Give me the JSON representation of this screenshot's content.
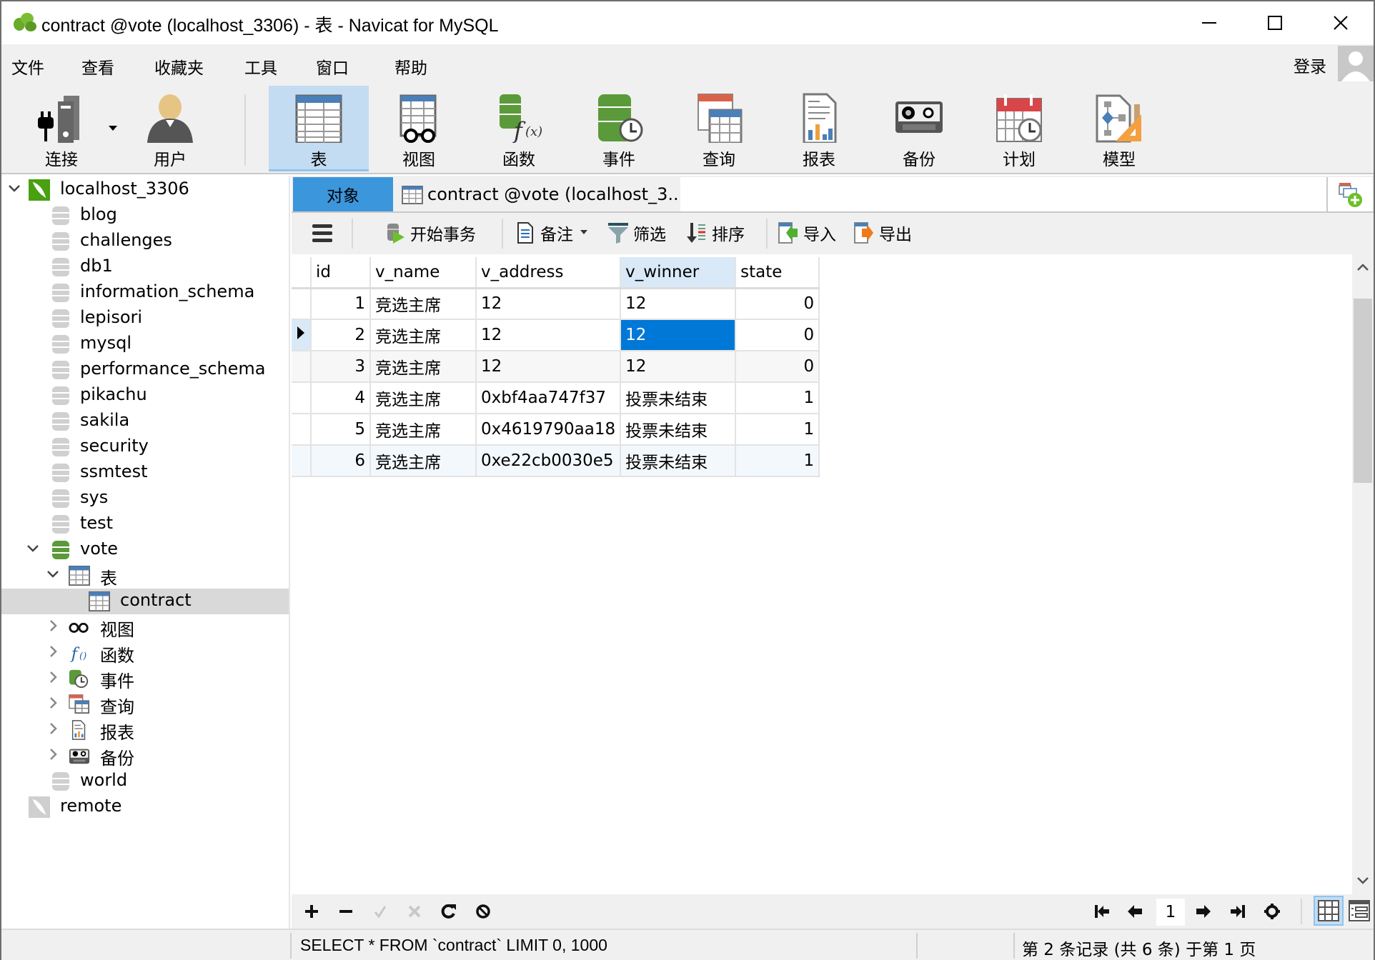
{
  "window": {
    "title": "contract @vote (localhost_3306) - 表 - Navicat for MySQL"
  },
  "menu": {
    "items": [
      "文件",
      "查看",
      "收藏夹",
      "工具",
      "窗口",
      "帮助"
    ],
    "login_label": "登录"
  },
  "toolbar": {
    "items": [
      {
        "label": "连接",
        "icon": "connection-plug-icon"
      },
      {
        "label": "用户",
        "icon": "user-icon"
      },
      {
        "label": "表",
        "icon": "table-icon",
        "active": true
      },
      {
        "label": "视图",
        "icon": "view-glasses-icon"
      },
      {
        "label": "函数",
        "icon": "function-icon"
      },
      {
        "label": "事件",
        "icon": "event-clock-icon"
      },
      {
        "label": "查询",
        "icon": "query-icon"
      },
      {
        "label": "报表",
        "icon": "report-icon"
      },
      {
        "label": "备份",
        "icon": "backup-icon"
      },
      {
        "label": "计划",
        "icon": "schedule-calendar-icon"
      },
      {
        "label": "模型",
        "icon": "model-icon"
      }
    ]
  },
  "sidebar": {
    "connection": "localhost_3306",
    "databases": [
      "blog",
      "challenges",
      "db1",
      "information_schema",
      "lepisori",
      "mysql",
      "performance_schema",
      "pikachu",
      "sakila",
      "security",
      "ssmtest",
      "sys",
      "test"
    ],
    "open_database": "vote",
    "tables_folder": "表",
    "selected_table": "contract",
    "folders": [
      "视图",
      "函数",
      "事件",
      "查询",
      "报表",
      "备份"
    ],
    "after_databases": [
      "world"
    ],
    "other_connection": "remote"
  },
  "tabs": {
    "objects_label": "对象",
    "active_tab_label": "contract @vote (localhost_3..."
  },
  "grid_toolbar": {
    "begin_transaction": "开始事务",
    "memo": "备注",
    "filter": "筛选",
    "sort": "排序",
    "import": "导入",
    "export": "导出"
  },
  "table": {
    "columns": [
      "id",
      "v_name",
      "v_address",
      "v_winner",
      "state"
    ],
    "selected_column": "v_winner",
    "current_row": 2,
    "rows": [
      {
        "id": "1",
        "v_name": "竞选主席",
        "v_address": "12",
        "v_winner": "12",
        "state": "0"
      },
      {
        "id": "2",
        "v_name": "竞选主席",
        "v_address": "12",
        "v_winner": "12",
        "state": "0"
      },
      {
        "id": "3",
        "v_name": "竞选主席",
        "v_address": "12",
        "v_winner": "12",
        "state": "0"
      },
      {
        "id": "4",
        "v_name": "竞选主席",
        "v_address": "0xbf4aa747f37",
        "v_winner": "投票未结束",
        "state": "1"
      },
      {
        "id": "5",
        "v_name": "竞选主席",
        "v_address": "0x4619790aa18",
        "v_winner": "投票未结束",
        "state": "1"
      },
      {
        "id": "6",
        "v_name": "竞选主席",
        "v_address": "0xe22cb0030e5",
        "v_winner": "投票未结束",
        "state": "1"
      }
    ]
  },
  "pager": {
    "page": "1"
  },
  "status": {
    "sql": "SELECT * FROM `contract` LIMIT 0, 1000",
    "records": "第 2 条记录 (共 6 条) 于第 1 页"
  },
  "colors": {
    "accent_blue": "#3c96dc",
    "selected_cell": "#0078d7",
    "toolbar_active": "#c3dcf2",
    "db_green": "#5b9a3a",
    "chrome_bg": "#f0f0f0"
  }
}
